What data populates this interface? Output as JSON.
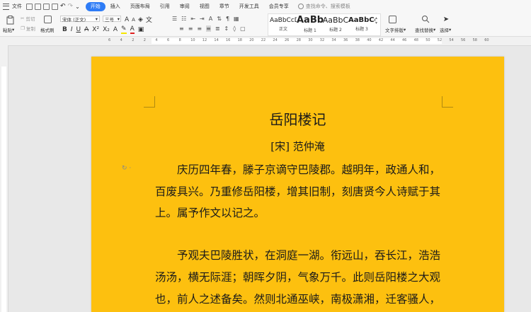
{
  "menu": {
    "file_label": "文件",
    "tabs": [
      "开始",
      "插入",
      "页面布局",
      "引用",
      "审阅",
      "视图",
      "章节",
      "开发工具",
      "会员专享"
    ],
    "active_tab": "开始",
    "search_placeholder": "查找命令、搜索模板"
  },
  "ribbon": {
    "paste": "粘贴",
    "cut": "剪切",
    "copy": "复制",
    "format_painter": "格式刷",
    "font_name": "宋体 (正文)",
    "font_size": "三号",
    "styles": [
      {
        "preview": "AaBbCcDd",
        "label": "正文"
      },
      {
        "preview": "AaBb",
        "label": "标题 1"
      },
      {
        "preview": "AaBbC",
        "label": "标题 2"
      },
      {
        "preview": "AaBbCc",
        "label": "标题 3"
      }
    ],
    "text_layout": "文字排版",
    "find_replace": "查找替换",
    "select": "选择"
  },
  "ruler_numbers": [
    "6",
    "4",
    "2",
    "2",
    "4",
    "6",
    "8",
    "10",
    "12",
    "14",
    "16",
    "18",
    "20",
    "22",
    "24",
    "26",
    "28",
    "30",
    "32",
    "34",
    "36",
    "38",
    "40",
    "42",
    "44",
    "46",
    "48",
    "50",
    "52",
    "54",
    "56",
    "58",
    "60"
  ],
  "document": {
    "title": "岳阳楼记",
    "author": "[宋]  范仲淹",
    "lines": [
      "庆历四年春，滕子京谪守巴陵郡。越明年，政通人和，",
      "百废具兴。乃重修岳阳楼，增其旧制，刻唐贤今人诗赋于其",
      "上。属予作文以记之。",
      "予观夫巴陵胜状，在洞庭一湖。衔远山，吞长江，浩浩",
      "汤汤，横无际涯；朝晖夕阴，气象万千。此则岳阳楼之大观",
      "也，前人之述备矣。然则北通巫峡，南极潇湘，迁客骚人，"
    ],
    "page_color": "#fdc00f"
  }
}
